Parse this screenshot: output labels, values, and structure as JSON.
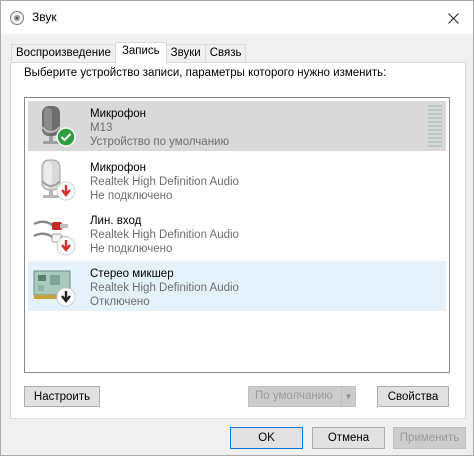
{
  "window": {
    "title": "Звук"
  },
  "tabs": [
    {
      "label": "Воспроизведение",
      "active": false
    },
    {
      "label": "Запись",
      "active": true
    },
    {
      "label": "Звуки",
      "active": false
    },
    {
      "label": "Связь",
      "active": false
    }
  ],
  "panel": {
    "hint": "Выберите устройство записи, параметры которого нужно изменить:"
  },
  "devices": [
    {
      "name": "Микрофон",
      "model": "M13",
      "status": "Устройство по умолчанию",
      "icon": "microphone-default-icon",
      "state": "selected"
    },
    {
      "name": "Микрофон",
      "model": "Realtek High Definition Audio",
      "status": "Не подключено",
      "icon": "microphone-disconnected-icon",
      "state": "normal"
    },
    {
      "name": "Лин. вход",
      "model": "Realtek High Definition Audio",
      "status": "Не подключено",
      "icon": "line-in-disconnected-icon",
      "state": "normal"
    },
    {
      "name": "Стерео микшер",
      "model": "Realtek High Definition Audio",
      "status": "Отключено",
      "icon": "stereo-mix-disabled-icon",
      "state": "hover"
    }
  ],
  "buttons": {
    "configure": "Настроить",
    "set_default": "По умолчанию",
    "properties": "Свойства",
    "ok": "OK",
    "cancel": "Отмена",
    "apply": "Применить"
  },
  "colors": {
    "selected_row": "#d9d9d9",
    "hover_row": "#e5f1fb",
    "default_check": "#2e9e3f",
    "disconnected_arrow": "#d32f2f"
  }
}
